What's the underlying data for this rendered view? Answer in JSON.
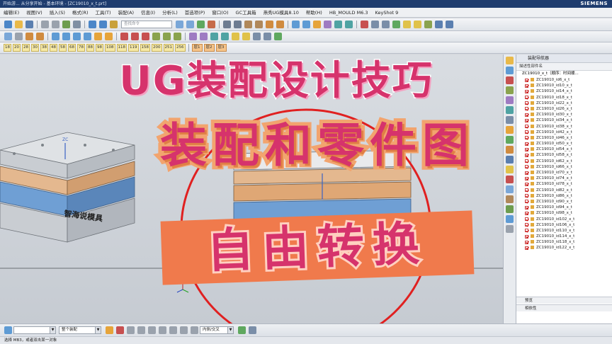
{
  "window": {
    "title": "开始游... 从分享开始 - 基本环境 - [ZC19010_x_t.prt]",
    "brand": "SIEMENS"
  },
  "menubar": {
    "items": [
      "编辑(E)",
      "视图(V)",
      "插入(S)",
      "格式(R)",
      "工具(T)",
      "装配(A)",
      "信息(I)",
      "分析(L)",
      "首选项(P)",
      "窗口(O)",
      "GC工具箱",
      "燕秀UG模具8.10",
      "帮助(H)",
      "HB_MOULD M6.3",
      "KeyShot 9"
    ]
  },
  "toolbar": {
    "search_placeholder": "查找命令",
    "numbers": [
      "18",
      "20",
      "28",
      "30",
      "38",
      "48",
      "58",
      "68",
      "78",
      "88",
      "98",
      "108",
      "118",
      "119",
      "158",
      "200",
      "251",
      "256"
    ],
    "layers": [
      "层1",
      "层2",
      "层3"
    ]
  },
  "canvas": {
    "watermark": "智海说模具",
    "axis_label_left": "ZC",
    "axis_label_center": "ZC"
  },
  "overlay": {
    "line1": "UG装配设计技巧",
    "line2": "装配和零件图",
    "line3": "自由转换"
  },
  "navigator": {
    "title": "装配导航器",
    "column_header": "描述性部件名",
    "root": "ZC19010_x_t（顺序：时间顺...",
    "parts": [
      "ZC19010_id6_x_t",
      "ZC19010_id10_x_t",
      "ZC19010_id14_x_t",
      "ZC19010_id18_x_t",
      "ZC19010_id22_x_t",
      "ZC19010_id26_x_t",
      "ZC19010_id30_x_t",
      "ZC19010_id34_x_t",
      "ZC19010_id38_x_t",
      "ZC19010_id42_x_t",
      "ZC19010_id46_x_t",
      "ZC19010_id50_x_t",
      "ZC19010_id54_x_t",
      "ZC19010_id58_x_t",
      "ZC19010_id62_x_t",
      "ZC19010_id66_x_t",
      "ZC19010_id70_x_t",
      "ZC19010_id74_x_t",
      "ZC19010_id78_x_t",
      "ZC19010_id82_x_t",
      "ZC19010_id86_x_t",
      "ZC19010_id90_x_t",
      "ZC19010_id94_x_t",
      "ZC19010_id98_x_t",
      "ZC19010_id102_x_t",
      "ZC19010_id106_x_t",
      "ZC19010_id110_x_t",
      "ZC19010_id114_x_t",
      "ZC19010_id118_x_t",
      "ZC19010_id122_x_t"
    ],
    "section_preview": "预览",
    "section_dependencies": "相依性"
  },
  "bottombar": {
    "filter_value": "整个装配",
    "intersect_value": "内侧/交叉"
  },
  "status": {
    "text": "选择 MB3，或者双击某一对象"
  },
  "colors": {
    "accent_pink": "#d6336c",
    "accent_orange": "#f07a4c",
    "plate_orange": "#c8884f",
    "plate_blue": "#5f8fc4",
    "plate_gray": "#d7dadd",
    "circle_red": "#e02020"
  }
}
